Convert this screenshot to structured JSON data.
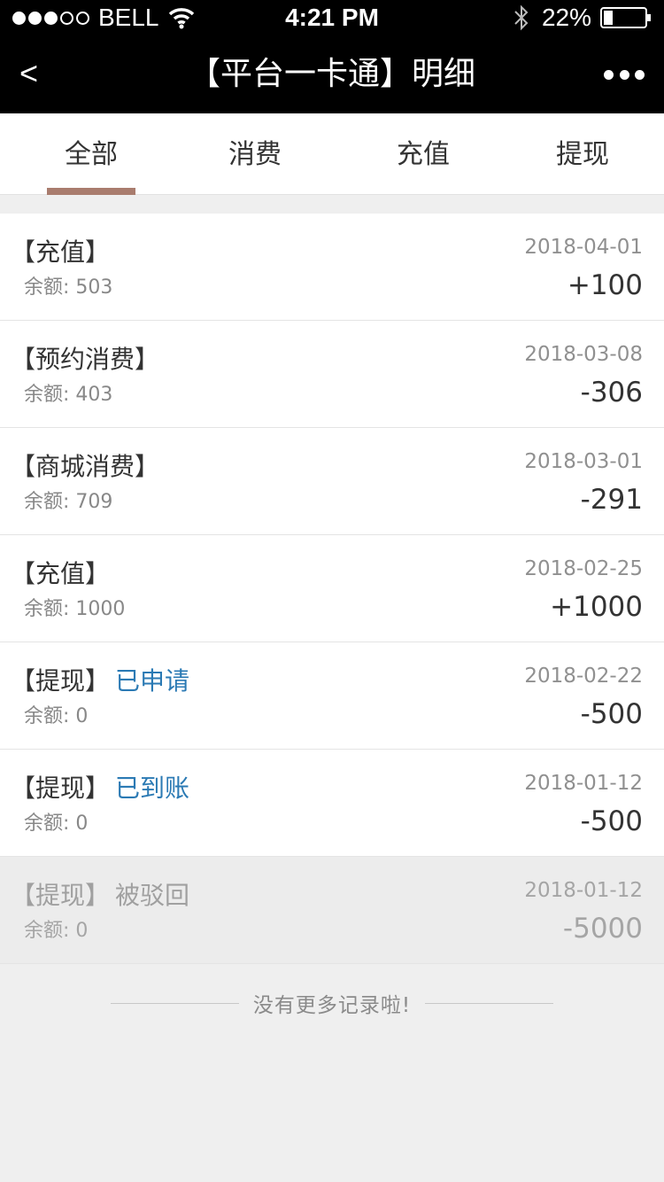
{
  "status_bar": {
    "carrier": "BELL",
    "time": "4:21 PM",
    "battery": "22%",
    "signal_strength": 3,
    "signal_max": 5
  },
  "nav": {
    "back_label": "<",
    "title": "【平台一卡通】明细"
  },
  "tabs": [
    {
      "label": "全部",
      "active": true
    },
    {
      "label": "消费",
      "active": false
    },
    {
      "label": "充值",
      "active": false
    },
    {
      "label": "提现",
      "active": false
    }
  ],
  "records": [
    {
      "title": "【充值】",
      "status": "",
      "balance": "余额: 503",
      "date": "2018-04-01",
      "amount": "+100"
    },
    {
      "title": "【预约消费】",
      "status": "",
      "balance": "余额: 403",
      "date": "2018-03-08",
      "amount": "-306"
    },
    {
      "title": "【商城消费】",
      "status": "",
      "balance": "余额: 709",
      "date": "2018-03-01",
      "amount": "-291"
    },
    {
      "title": "【充值】",
      "status": "",
      "balance": "余额: 1000",
      "date": "2018-02-25",
      "amount": "+1000"
    },
    {
      "title": "【提现】",
      "status": "已申请",
      "balance": "余额: 0",
      "date": "2018-02-22",
      "amount": "-500"
    },
    {
      "title": "【提现】",
      "status": "已到账",
      "balance": "余额: 0",
      "date": "2018-01-12",
      "amount": "-500"
    },
    {
      "title": "【提现】",
      "status": "被驳回",
      "balance": "余额: 0",
      "date": "2018-01-12",
      "amount": "-5000"
    }
  ],
  "footer_note": "没有更多记录啦!",
  "colors": {
    "accent_underline": "#a97c6e",
    "status_blue": "#2b7ab4",
    "bar_background": "#000000"
  }
}
